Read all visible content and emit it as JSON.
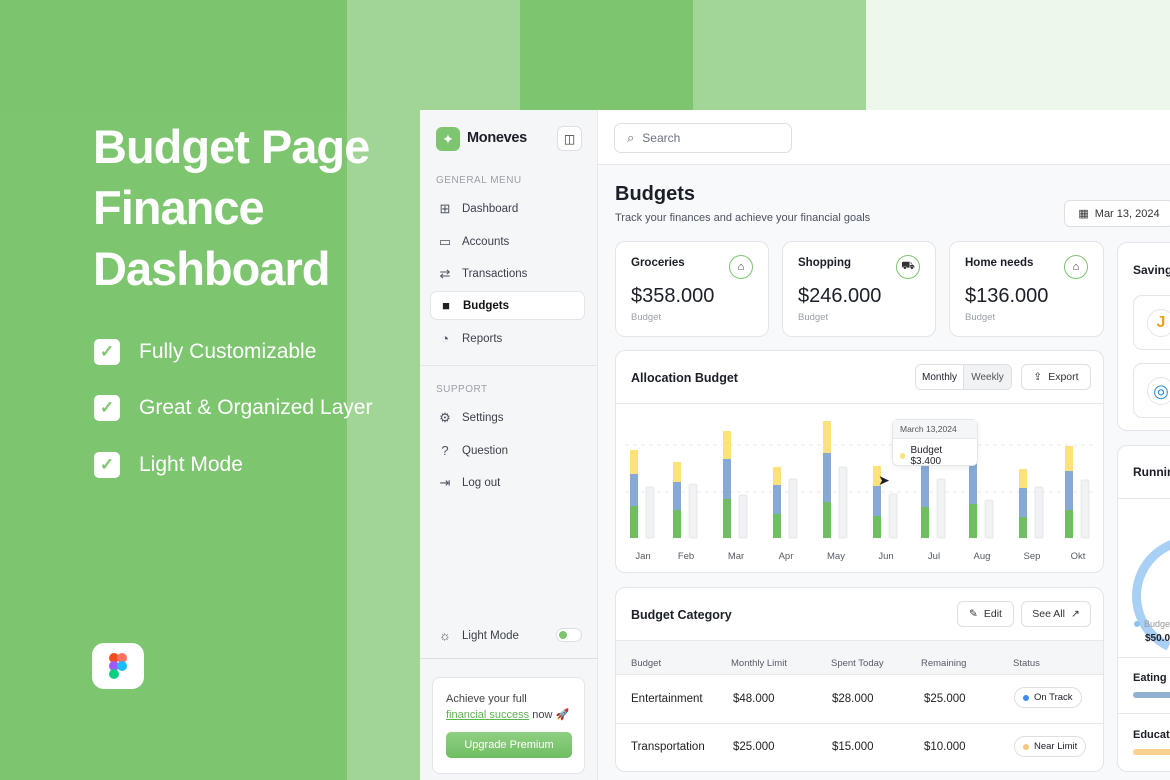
{
  "colors": {
    "brand": "#7dc56f",
    "green": "#6fbf62",
    "blue": "#86a9d6",
    "yellow": "#fde17a",
    "grey_bar": "#f1f2f4"
  },
  "hero": {
    "title_lines": [
      "Budget Page",
      "Finance",
      "Dashboard"
    ],
    "features": [
      "Fully Customizable",
      "Great & Organized Layer",
      "Light Mode"
    ]
  },
  "app": {
    "name": "Moneves",
    "search_placeholder": "Search"
  },
  "sidebar": {
    "general_heading": "GENERAL MENU",
    "general": [
      {
        "label": "Dashboard",
        "icon": "grid-icon"
      },
      {
        "label": "Accounts",
        "icon": "card-icon"
      },
      {
        "label": "Transactions",
        "icon": "swap-icon"
      },
      {
        "label": "Budgets",
        "icon": "archive-icon",
        "active": true
      },
      {
        "label": "Reports",
        "icon": "pie-icon"
      }
    ],
    "support_heading": "SUPPORT",
    "support": [
      {
        "label": "Settings",
        "icon": "gear-icon"
      },
      {
        "label": "Question",
        "icon": "question-icon"
      },
      {
        "label": "Log out",
        "icon": "logout-icon"
      }
    ],
    "light_mode_label": "Light Mode",
    "light_mode_on": true,
    "promo": {
      "text1": "Achieve your full",
      "link": "financial success",
      "text2": "now 🚀",
      "button": "Upgrade Premium"
    }
  },
  "page": {
    "title": "Budgets",
    "subtitle": "Track your finances and achieve your financial goals",
    "date": "Mar 13, 2024"
  },
  "summary_cards": [
    {
      "label": "Groceries",
      "value": "$358.000",
      "sub": "Budget",
      "icon": "bag-icon"
    },
    {
      "label": "Shopping",
      "value": "$246.000",
      "sub": "Budget",
      "icon": "cart-icon"
    },
    {
      "label": "Home needs",
      "value": "$136.000",
      "sub": "Budget",
      "icon": "home-icon"
    }
  ],
  "allocation": {
    "title": "Allocation Budget",
    "tabs": [
      "Monthly",
      "Weekly"
    ],
    "active_tab": "Weekly",
    "export": "Export",
    "tooltip": {
      "date": "March 13,2024",
      "label": "Budget $3.400"
    }
  },
  "chart_data": {
    "type": "bar",
    "stacked": true,
    "grid": "dashed horizontal",
    "categories": [
      "Jan",
      "Feb",
      "Mar",
      "Apr",
      "May",
      "Jun",
      "Jul",
      "Aug",
      "Sep",
      "Okt"
    ],
    "series": [
      {
        "color": "#6fbf62",
        "values": [
          32,
          28,
          39,
          24,
          36,
          22,
          31,
          34,
          21,
          28
        ]
      },
      {
        "color": "#86a9d6",
        "values": [
          32,
          28,
          40,
          29,
          49,
          30,
          45,
          44,
          29,
          39
        ]
      },
      {
        "color": "#fde17a",
        "values": [
          24,
          20,
          28,
          18,
          32,
          20,
          22,
          20,
          19,
          25
        ]
      }
    ],
    "comparison": {
      "color": "#f1f2f4",
      "values": [
        51,
        54,
        43,
        59,
        71,
        44,
        59,
        38,
        51,
        58
      ]
    }
  },
  "category": {
    "title": "Budget Category",
    "edit": "Edit",
    "see_all": "See All",
    "columns": [
      "Budget",
      "Monthly Limit",
      "Spent Today",
      "Remaining",
      "Status"
    ],
    "rows": [
      {
        "budget": "Entertainment",
        "limit": "$48.000",
        "spent": "$28.000",
        "remaining": "$25.000",
        "status": "On Track",
        "status_color": "#3b8df0"
      },
      {
        "budget": "Transportation",
        "limit": "$25.000",
        "spent": "$15.000",
        "remaining": "$10.000",
        "status": "Near Limit",
        "status_color": "#f7c680"
      }
    ]
  },
  "right": {
    "savings_title": "Saving",
    "running_title": "Runnin",
    "legend": "Budge",
    "legend_value": "$50.0",
    "eating": "Eating &",
    "education": "Educati"
  }
}
